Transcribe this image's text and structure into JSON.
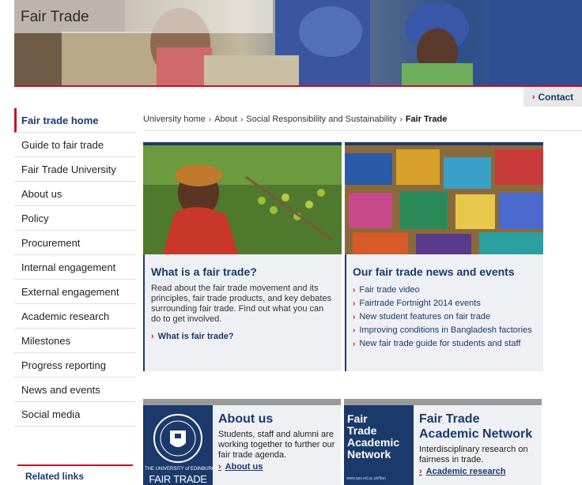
{
  "banner": {
    "title": "Fair Trade"
  },
  "contact": {
    "label": "Contact"
  },
  "sidebar": {
    "items": [
      {
        "label": "Fair trade home"
      },
      {
        "label": "Guide to fair trade"
      },
      {
        "label": "Fair Trade University"
      },
      {
        "label": "About us"
      },
      {
        "label": "Policy"
      },
      {
        "label": "Procurement"
      },
      {
        "label": "Internal engagement"
      },
      {
        "label": "External engagement"
      },
      {
        "label": "Academic research"
      },
      {
        "label": "Milestones"
      },
      {
        "label": "Progress reporting"
      },
      {
        "label": "News and events"
      },
      {
        "label": "Social media"
      }
    ],
    "related_links": "Related links"
  },
  "breadcrumb": {
    "items": [
      "University home",
      "About",
      "Social Responsibility and Sustainability"
    ],
    "current": "Fair Trade"
  },
  "feature_left": {
    "title": "What is a fair trade?",
    "text": "Read about the fair trade movement and its principles, fair trade products, and key debates surrounding fair trade. Find out what you can do to get involved.",
    "link": "What is fair trade?"
  },
  "feature_right": {
    "title": "Our fair trade news and events",
    "items": [
      "Fair trade video",
      "Fairtrade Fortnight 2014 events",
      "New student features on fair trade",
      "Improving conditions in Bangladesh factories",
      "New fair trade guide for students and staff"
    ]
  },
  "about_card": {
    "title": "About us",
    "text": "Students, staff and alumni are working together to further our fair trade agenda.",
    "link": "About us",
    "logo_top": "THE UNIVERSITY of EDINBURGH",
    "logo_bottom": "FAIR TRADE"
  },
  "network_card": {
    "title": "Fair Trade Academic Network",
    "text": "Interdisciplinary research on fairness in trade.",
    "link": "Academic research",
    "logo_text": [
      "Fair",
      "Trade",
      "Academic",
      "Network"
    ],
    "logo_url": "www.sps.ed.ac.uk/ftan"
  },
  "colors": {
    "brand_navy": "#1b3a6b",
    "accent_red": "#c8102e"
  }
}
